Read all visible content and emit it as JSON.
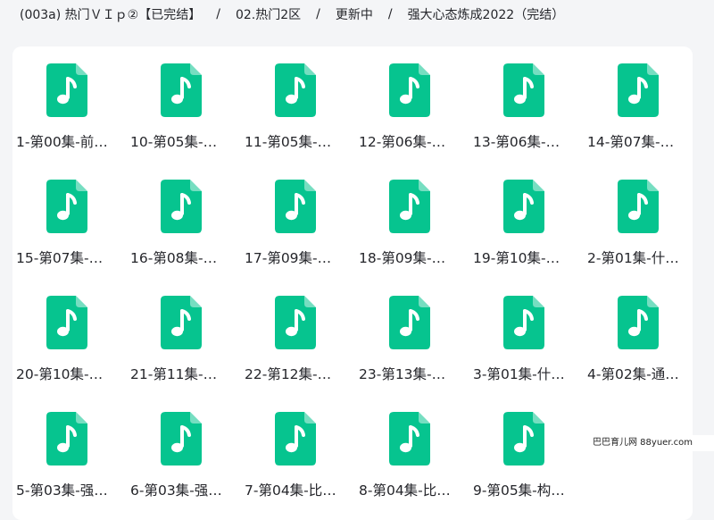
{
  "breadcrumb": [
    "(003a) 热门ＶＩｐ②【已完结】",
    "02.热门2区",
    "更新中",
    "强大心态炼成2022（完结）"
  ],
  "breadcrumb_separator": "/",
  "file_icon": {
    "name": "audio-file-icon",
    "color": "#06c48f",
    "glyph": "music-note"
  },
  "files": [
    "1-第00集-前…",
    "10-第05集-…",
    "11-第05集-…",
    "12-第06集-…",
    "13-第06集-…",
    "14-第07集-…",
    "15-第07集-…",
    "16-第08集-…",
    "17-第09集-…",
    "18-第09集-…",
    "19-第10集-…",
    "2-第01集-什…",
    "20-第10集-…",
    "21-第11集-…",
    "22-第12集-…",
    "23-第13集-…",
    "3-第01集-什…",
    "4-第02集-通…",
    "5-第03集-强…",
    "6-第03集-强…",
    "7-第04集-比…",
    "8-第04集-比…",
    "9-第05集-构…"
  ],
  "watermark": "巴巴育儿网 88yuer.com"
}
